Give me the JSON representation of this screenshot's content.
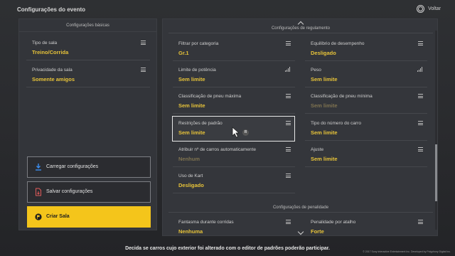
{
  "header": {
    "title": "Configurações do evento",
    "back_label": "Voltar"
  },
  "left_panel": {
    "title": "Configurações básicas",
    "settings": [
      {
        "name": "Tipo de sala",
        "value": "Treino/Corrida"
      },
      {
        "name": "Privacidade da sala",
        "value": "Somente amigos"
      }
    ],
    "buttons": {
      "load": "Carregar configurações",
      "save": "Salvar configurações",
      "create": "Criar Sala"
    }
  },
  "right_panel": {
    "regulation_title": "Configurações de regulamento",
    "penalty_title": "Configurações de penalidade",
    "settings": [
      {
        "name": "Filtrar por categoria",
        "value": "Gr.1"
      },
      {
        "name": "Equilíbrio de desempenho",
        "value": "Desligado"
      },
      {
        "name": "Limite de potência",
        "value": "Sem limite"
      },
      {
        "name": "Peso",
        "value": "Sem limite"
      },
      {
        "name": "Classificação de pneu máxima",
        "value": "Sem limite"
      },
      {
        "name": "Classificação de pneu mínima",
        "value": "Sem limite"
      },
      {
        "name": "Restrições de padrão",
        "value": "Sem limite"
      },
      {
        "name": "Tipo do número do carro",
        "value": "Sem limite"
      },
      {
        "name": "Atribuir nº de carros automaticamente",
        "value": "Nenhum"
      },
      {
        "name": "Ajuste",
        "value": "Sem limite"
      },
      {
        "name": "Uso de Kart",
        "value": "Desligado"
      }
    ],
    "penalty_settings": [
      {
        "name": "Fantasma durante corridas",
        "value": "Nenhuma"
      },
      {
        "name": "Penalidade por atalho",
        "value": "Forte"
      }
    ]
  },
  "cursor_badge": "R",
  "footer": {
    "hint": "Decida se carros cujo exterior foi alterado com o editor de padrões poderão participar.",
    "copyright": "© 2017 Sony Interactive Entertainment Inc. Developed by Polyphony Digital Inc."
  },
  "colors": {
    "accent": "#f4c51b",
    "value_yellow": "#e7c339",
    "value_dim": "#7f7350"
  }
}
